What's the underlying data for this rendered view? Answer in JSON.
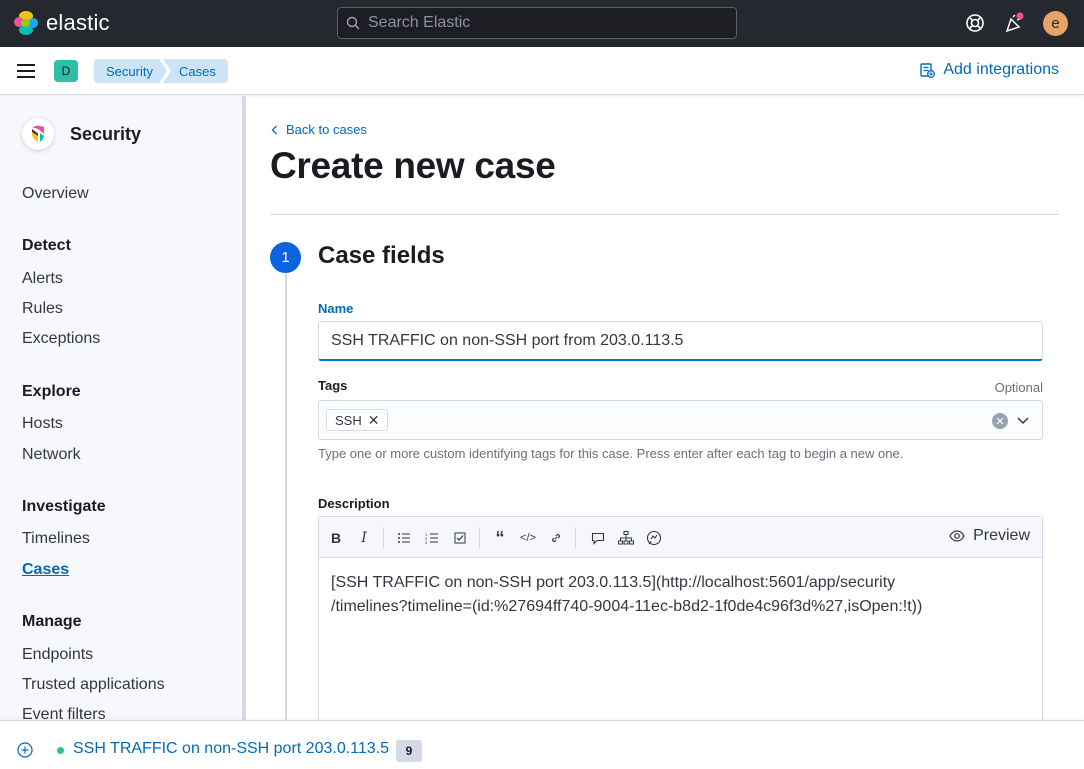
{
  "header": {
    "logo_text": "elastic",
    "search_placeholder": "Search Elastic",
    "avatar_initial": "e"
  },
  "subheader": {
    "space_initial": "D",
    "breadcrumbs": [
      "Security",
      "Cases"
    ],
    "add_integrations": "Add integrations"
  },
  "sidebar": {
    "title": "Security",
    "overview": "Overview",
    "groups": {
      "detect": "Detect",
      "explore": "Explore",
      "investigate": "Investigate",
      "manage": "Manage"
    },
    "items": {
      "alerts": "Alerts",
      "rules": "Rules",
      "exceptions": "Exceptions",
      "hosts": "Hosts",
      "network": "Network",
      "timelines": "Timelines",
      "cases": "Cases",
      "endpoints": "Endpoints",
      "trusted_applications": "Trusted applications",
      "event_filters": "Event filters"
    }
  },
  "main": {
    "back_link": "Back to cases",
    "title": "Create new case",
    "step_number": "1",
    "step_title": "Case fields",
    "name_label": "Name",
    "name_value": "SSH TRAFFIC on non-SSH port from 203.0.113.5",
    "tags_label": "Tags",
    "tags_optional": "Optional",
    "tags": [
      "SSH"
    ],
    "tags_help": "Type one or more custom identifying tags for this case. Press enter after each tag to begin a new one.",
    "description_label": "Description",
    "preview_label": "Preview",
    "description_value": "[SSH TRAFFIC on non-SSH port 203.0.113.5](http://localhost:5601/app/security/timelines?timeline=(id:%27694ff740-9004-11ec-b8d2-1f0de4c96f3d%27,isOpen:!t))",
    "description_line1": "[SSH TRAFFIC on non-SSH port 203.0.113.5](http://localhost:5601/app/security",
    "description_line2": "/timelines?timeline=(id:%27694ff740-9004-11ec-b8d2-1f0de4c96f3d%27,isOpen:!t))"
  },
  "timeline_bar": {
    "title": "SSH TRAFFIC on non-SSH port 203.0.113.5",
    "count": "9"
  },
  "colors": {
    "accent": "#006bb8",
    "step": "#0b64dd",
    "header_bg": "#25282f",
    "space_badge": "#2fbfa8"
  }
}
